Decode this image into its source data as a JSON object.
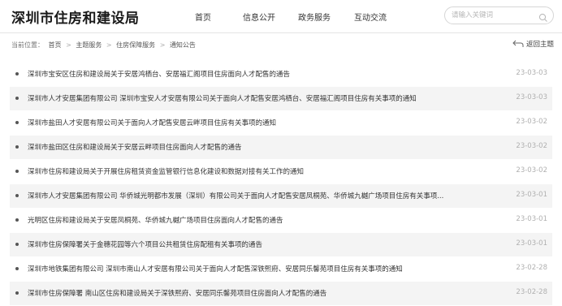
{
  "header": {
    "logo": "深圳市住房和建设局",
    "nav": [
      "首页",
      "信息公开",
      "政务服务",
      "互动交流"
    ],
    "search_placeholder": "请输入关键词"
  },
  "breadcrumb": {
    "label": "当前位置：",
    "items": [
      "首页",
      "主题服务",
      "住房保障服务",
      "通知公告"
    ],
    "separator": ">"
  },
  "back_label": "返回主题",
  "items": [
    {
      "title": "深圳市宝安区住房和建设局关于安居鸿栖台、安居福汇阁项目住房面向人才配售的通告",
      "date": "23-03-03"
    },
    {
      "title": "深圳市人才安居集团有限公司 深圳市宝安人才安居有限公司关于面向人才配售安居鸿栖台、安居福汇阁项目住房有关事项的通知",
      "date": "23-03-03"
    },
    {
      "title": "深圳市盐田人才安居有限公司关于面向人才配售安居云畔项目住房有关事项的通知",
      "date": "23-03-02"
    },
    {
      "title": "深圳市盐田区住房和建设局关于安居云畔项目住房面向人才配售的通告",
      "date": "23-03-02"
    },
    {
      "title": "深圳市住房和建设局关于开展住房租赁资金监管银行信息化建设和数据对接有关工作的通知",
      "date": "23-03-02"
    },
    {
      "title": "深圳市人才安居集团有限公司 华侨城光明都市发展（深圳）有限公司关于面向人才配售安居凤桐苑、华侨城九樾广场项目住房有关事项...",
      "date": "23-03-01"
    },
    {
      "title": "光明区住房和建设局关于安居凤桐苑、华侨城九樾广场项目住房面向人才配售的通告",
      "date": "23-03-01"
    },
    {
      "title": "深圳市住房保障署关于金穗花园等六个项目公共租赁住房配租有关事项的通告",
      "date": "23-03-01"
    },
    {
      "title": "深圳市地铁集团有限公司 深圳市南山人才安居有限公司关于面向人才配售深铁熙府、安居同乐馨苑项目住房有关事项的通知",
      "date": "23-02-28"
    },
    {
      "title": "深圳市住房保障署 南山区住房和建设局关于深铁熙府、安居同乐馨苑项目住房面向人才配售的通告",
      "date": "23-02-28"
    }
  ]
}
